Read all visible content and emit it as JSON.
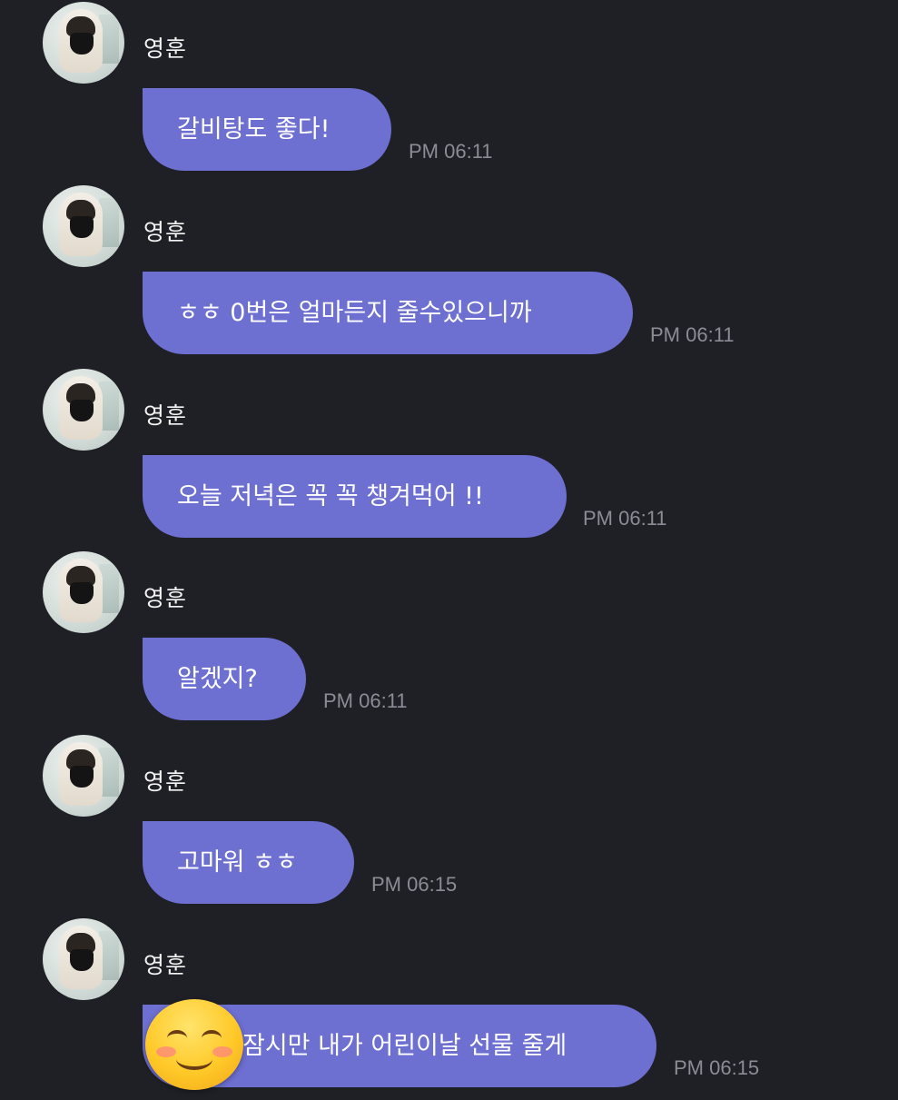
{
  "messages": [
    {
      "sender": "영훈",
      "text": "갈비탕도 좋다!",
      "time": "PM 06:11"
    },
    {
      "sender": "영훈",
      "text": "ㅎㅎ 0번은 얼마든지 줄수있으니까",
      "time": "PM 06:11"
    },
    {
      "sender": "영훈",
      "text": "오늘 저녁은 꼭 꼭 챙겨먹어 !!",
      "time": "PM 06:11"
    },
    {
      "sender": "영훈",
      "text": "알겠지?",
      "time": "PM 06:11"
    },
    {
      "sender": "영훈",
      "text": "고마워 ㅎㅎ",
      "time": "PM 06:15"
    },
    {
      "sender": "영훈",
      "text": "잠시만 내가 어린이날 선물 줄게",
      "time": "PM 06:15"
    }
  ],
  "overlay": {
    "icon": "smiling-face-emoji-icon"
  },
  "colors": {
    "background": "#1f1f26",
    "bubble": "#6d6fd1",
    "time": "#8c8c96"
  }
}
